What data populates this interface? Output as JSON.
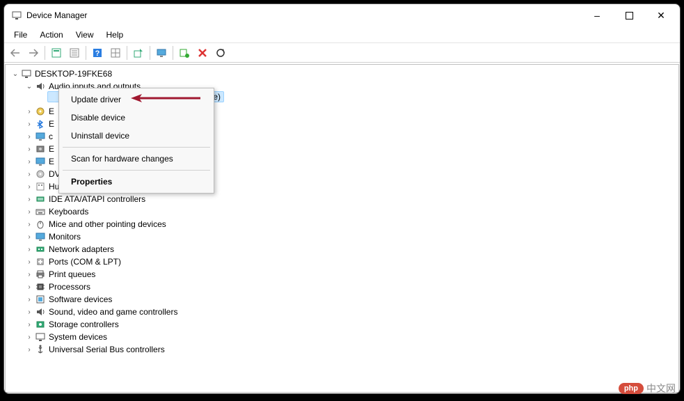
{
  "window": {
    "title": "Device Manager",
    "controls": {
      "minimize": "–",
      "maximize": "▢",
      "close": "✕"
    }
  },
  "menubar": [
    "File",
    "Action",
    "View",
    "Help"
  ],
  "toolbar": [
    {
      "name": "back-icon"
    },
    {
      "name": "forward-icon"
    },
    {
      "sep": true
    },
    {
      "name": "show-hidden-icon"
    },
    {
      "name": "properties-icon"
    },
    {
      "sep": true
    },
    {
      "name": "help-icon"
    },
    {
      "name": "grid-icon"
    },
    {
      "sep": true
    },
    {
      "name": "update-driver-icon"
    },
    {
      "sep": true
    },
    {
      "name": "monitor-icon"
    },
    {
      "sep": true
    },
    {
      "name": "uninstall-icon"
    },
    {
      "name": "disable-icon"
    },
    {
      "name": "scan-icon"
    }
  ],
  "tree": {
    "root": {
      "label": "DESKTOP-19FKE68",
      "expanded": true,
      "icon": "computer-icon"
    },
    "selected_device_hint": "e)",
    "audio": {
      "label": "Audio inputs and outputs",
      "expanded": true,
      "icon": "speaker-icon"
    },
    "categories": [
      {
        "label": "E",
        "icon": "disk-icon",
        "truncated": true
      },
      {
        "label": "E",
        "icon": "bluetooth-icon",
        "truncated": true
      },
      {
        "label": "c",
        "icon": "monitor-device-icon",
        "truncated": true
      },
      {
        "label": "E",
        "icon": "disk2-icon",
        "truncated": true
      },
      {
        "label": "E",
        "icon": "display-adapter-icon",
        "truncated": true
      },
      {
        "label": "DVD/CD-ROM drives",
        "icon": "dvd-icon"
      },
      {
        "label": "Human Interface Devices",
        "icon": "hid-icon"
      },
      {
        "label": "IDE ATA/ATAPI controllers",
        "icon": "ide-icon"
      },
      {
        "label": "Keyboards",
        "icon": "keyboard-icon"
      },
      {
        "label": "Mice and other pointing devices",
        "icon": "mouse-icon"
      },
      {
        "label": "Monitors",
        "icon": "monitor-device-icon"
      },
      {
        "label": "Network adapters",
        "icon": "network-icon"
      },
      {
        "label": "Ports (COM & LPT)",
        "icon": "port-icon"
      },
      {
        "label": "Print queues",
        "icon": "printer-icon"
      },
      {
        "label": "Processors",
        "icon": "cpu-icon"
      },
      {
        "label": "Software devices",
        "icon": "software-icon"
      },
      {
        "label": "Sound, video and game controllers",
        "icon": "sound-icon"
      },
      {
        "label": "Storage controllers",
        "icon": "storage-icon"
      },
      {
        "label": "System devices",
        "icon": "system-icon"
      },
      {
        "label": "Universal Serial Bus controllers",
        "icon": "usb-icon"
      }
    ]
  },
  "contextmenu": {
    "items": [
      {
        "label": "Update driver",
        "bold": false
      },
      {
        "label": "Disable device",
        "bold": false
      },
      {
        "label": "Uninstall device",
        "bold": false
      },
      {
        "sep": true
      },
      {
        "label": "Scan for hardware changes",
        "bold": false
      },
      {
        "sep": true
      },
      {
        "label": "Properties",
        "bold": true
      }
    ]
  },
  "watermark": {
    "badge": "php",
    "text": "中文网"
  }
}
